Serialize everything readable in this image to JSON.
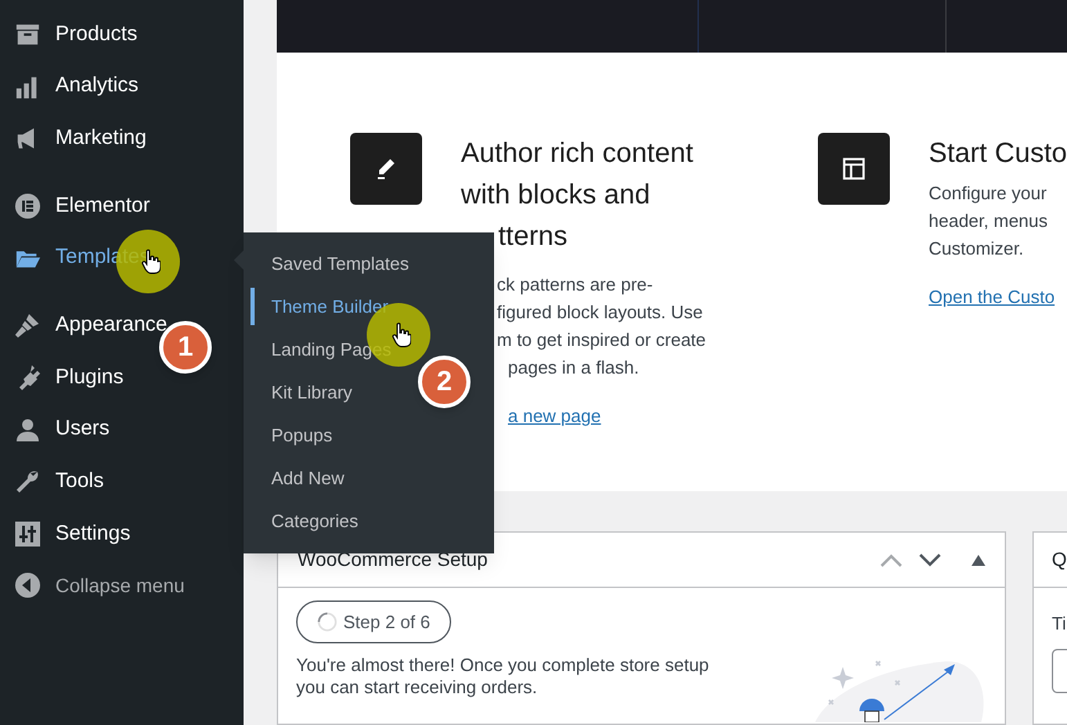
{
  "sidebar": {
    "groups": [
      [
        {
          "label": "Products",
          "selected": false
        },
        {
          "label": "Analytics",
          "selected": false
        },
        {
          "label": "Marketing",
          "selected": false
        }
      ],
      [
        {
          "label": "Elementor",
          "selected": false
        },
        {
          "label": "Templates",
          "selected": true
        }
      ],
      [
        {
          "label": "Appearance",
          "selected": false
        },
        {
          "label": "Plugins",
          "selected": false
        },
        {
          "label": "Users",
          "selected": false
        },
        {
          "label": "Tools",
          "selected": false
        },
        {
          "label": "Settings",
          "selected": false
        }
      ]
    ],
    "collapse": "Collapse menu"
  },
  "flyout": {
    "items": [
      {
        "label": "Saved Templates",
        "selected": false
      },
      {
        "label": "Theme Builder",
        "selected": true
      },
      {
        "label": "Landing Pages",
        "selected": false
      },
      {
        "label": "Kit Library",
        "selected": false
      },
      {
        "label": "Popups",
        "selected": false
      },
      {
        "label": "Add New",
        "selected": false
      },
      {
        "label": "Categories",
        "selected": false
      }
    ]
  },
  "welcome": {
    "cards": [
      {
        "title_lines": [
          "Author rich content",
          "with blocks and",
          "tterns"
        ],
        "text_lines": [
          "ck patterns are pre-",
          "figured block layouts. Use",
          "m to get inspired or create",
          "pages in a flash."
        ],
        "link": "a new page"
      },
      {
        "title_lines": [
          "Start Custo"
        ],
        "text_lines": [
          "Configure your",
          "header, menus",
          "Customizer."
        ],
        "link": "Open the Custo"
      }
    ]
  },
  "setup_panel": {
    "title": "WooCommerce Setup",
    "step": "Step 2 of 6",
    "text_lines": [
      "You're almost there! Once you complete store setup",
      "you can start receiving orders."
    ]
  },
  "side_panel": {
    "title": "Q",
    "label": "Ti"
  },
  "callouts": [
    "1",
    "2"
  ]
}
